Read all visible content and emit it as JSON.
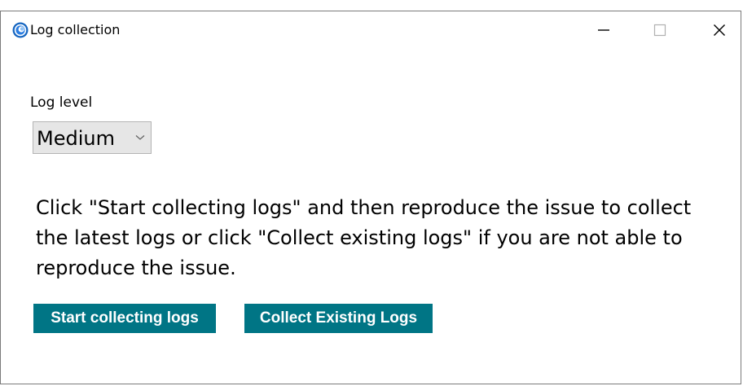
{
  "window": {
    "title": "Log collection",
    "controls": {
      "minimize": "minimize-icon",
      "maximize": "maximize-icon",
      "close": "close-icon"
    }
  },
  "log_level": {
    "label": "Log level",
    "selected": "Medium"
  },
  "instructions": "Click \"Start collecting logs\" and then reproduce the issue to collect the latest logs or click \"Collect existing logs\" if you are not able to reproduce the issue.",
  "buttons": {
    "start_label": "Start collecting logs",
    "collect_label": "Collect Existing Logs"
  },
  "colors": {
    "button_bg": "#007585",
    "button_text": "#ffffff",
    "select_bg": "#e6e6e6",
    "icon_blue": "#1a73e8"
  }
}
